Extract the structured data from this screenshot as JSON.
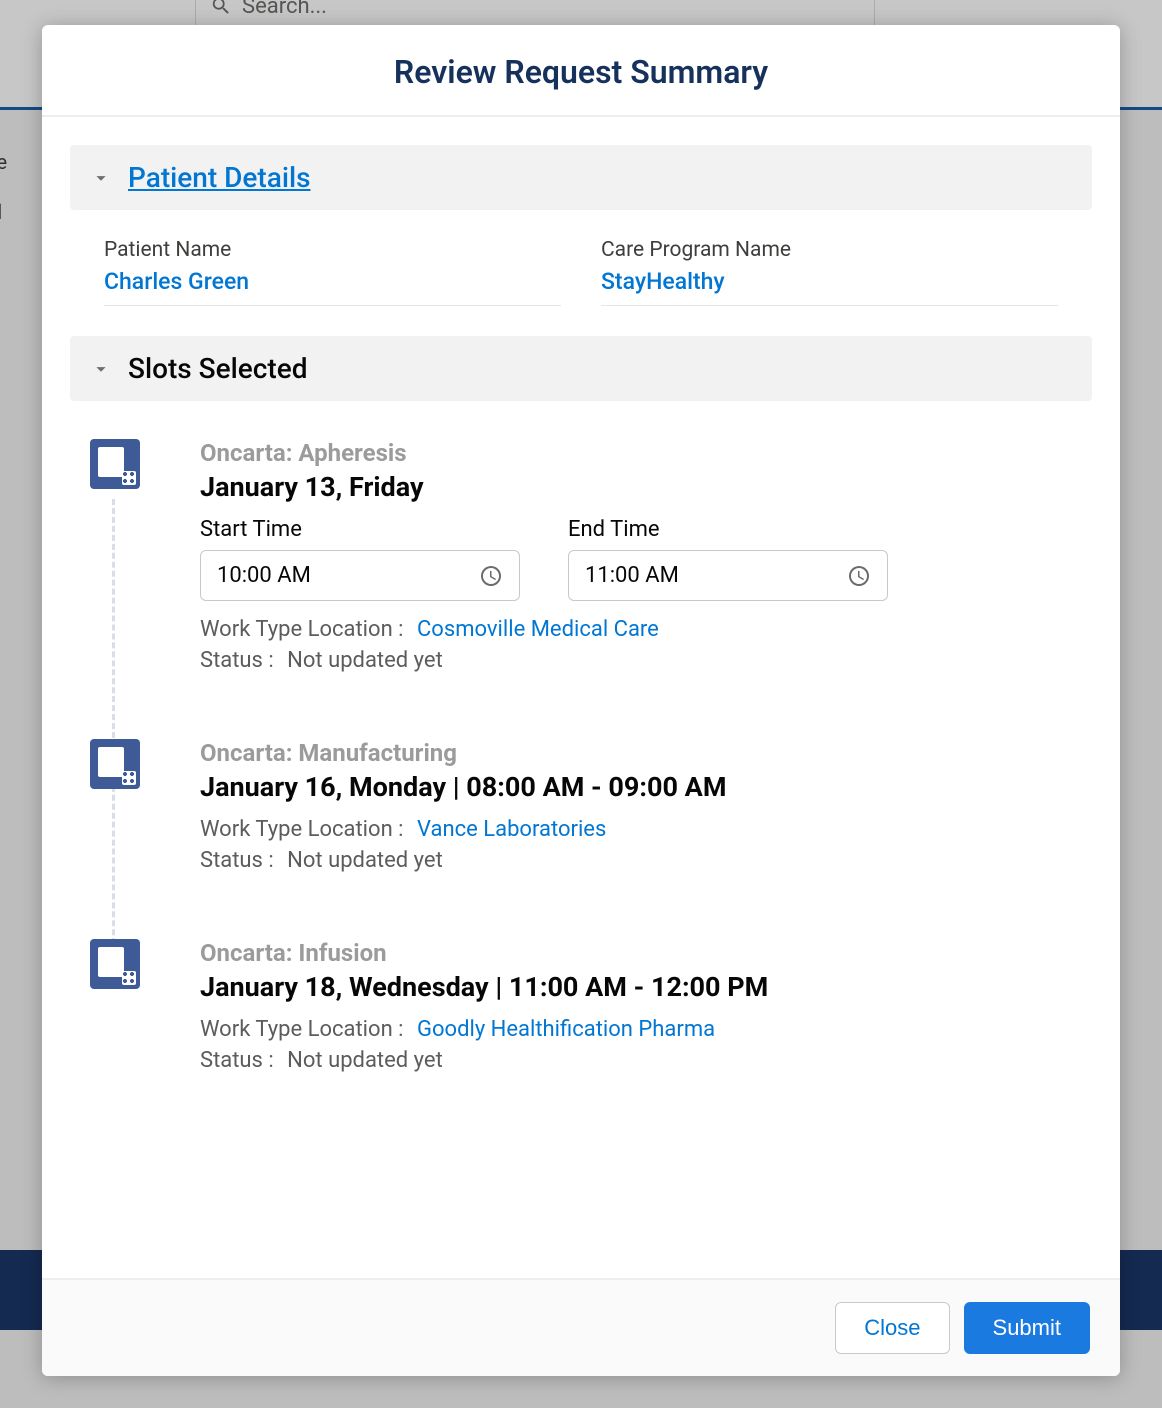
{
  "background": {
    "search_placeholder": "Search...",
    "tab_label": "anize",
    "sub_label": "tal"
  },
  "modal": {
    "title": "Review Request Summary",
    "patient_section_title": "Patient Details",
    "slots_section_title": "Slots Selected",
    "patient": {
      "name_label": "Patient Name",
      "name_value": "Charles Green",
      "program_label": "Care Program Name",
      "program_value": "StayHealthy"
    },
    "slots": [
      {
        "service": "Oncarta: Apheresis",
        "date_line": "January 13, Friday",
        "has_time_inputs": true,
        "start_label": "Start Time",
        "start_value": "10:00 AM",
        "end_label": "End Time",
        "end_value": "11:00 AM",
        "location_label": "Work Type Location :",
        "location_value": "Cosmoville Medical Care",
        "status_label": "Status :",
        "status_value": "Not updated yet"
      },
      {
        "service": "Oncarta: Manufacturing",
        "date_line": "January 16, Monday | 08:00 AM - 09:00 AM",
        "has_time_inputs": false,
        "location_label": "Work Type Location :",
        "location_value": "Vance Laboratories",
        "status_label": "Status :",
        "status_value": "Not updated yet"
      },
      {
        "service": "Oncarta: Infusion",
        "date_line": "January 18, Wednesday | 11:00 AM - 12:00 PM",
        "has_time_inputs": false,
        "location_label": "Work Type Location :",
        "location_value": "Goodly Healthification Pharma",
        "status_label": "Status :",
        "status_value": "Not updated yet"
      }
    ],
    "footer": {
      "close_label": "Close",
      "submit_label": "Submit"
    }
  }
}
